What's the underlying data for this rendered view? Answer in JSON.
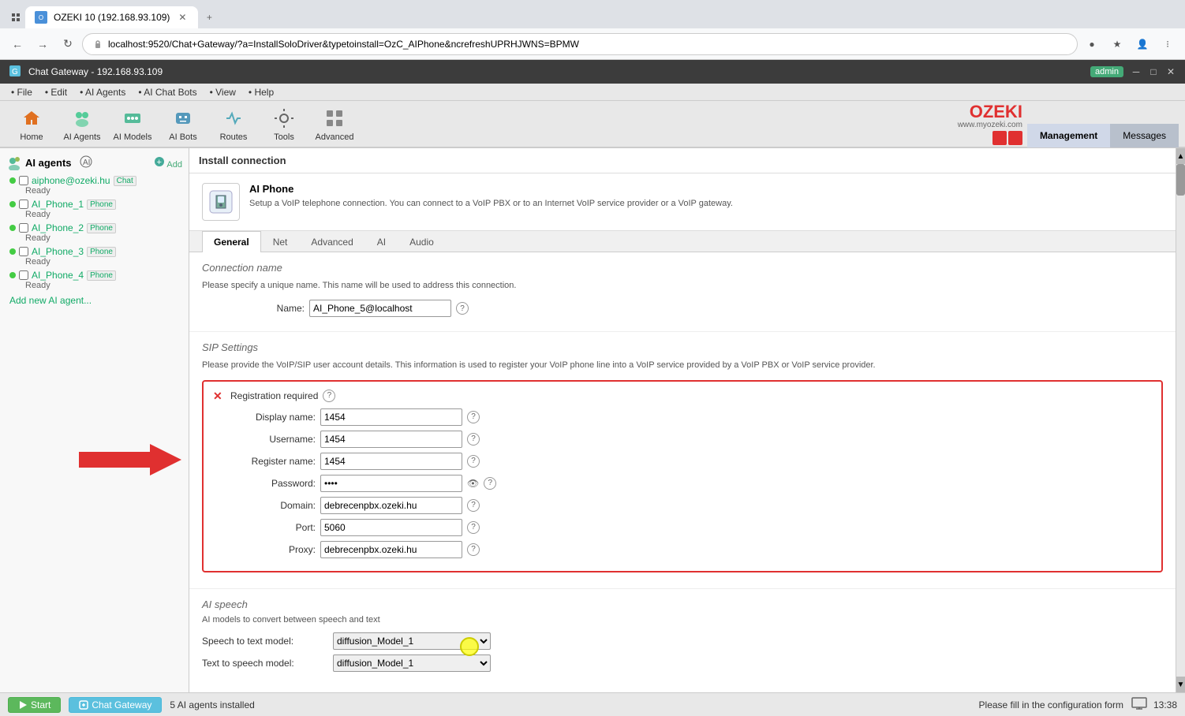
{
  "browser": {
    "tab_title": "OZEKI 10 (192.168.93.109)",
    "url": "localhost:9520/Chat+Gateway/?a=InstallSoloDriver&typetoinstall=OzC_AIPhone&ncrefreshUPRHJWNS=BPMW",
    "new_tab_symbol": "+"
  },
  "app": {
    "title": "Chat Gateway - 192.168.93.109",
    "admin_label": "admin"
  },
  "menubar": {
    "items": [
      "File",
      "Edit",
      "AI Agents",
      "AI Chat Bots",
      "View",
      "Help"
    ]
  },
  "toolbar": {
    "buttons": [
      {
        "id": "home",
        "label": "Home"
      },
      {
        "id": "ai-agents",
        "label": "AI Agents"
      },
      {
        "id": "ai-models",
        "label": "AI Models"
      },
      {
        "id": "ai-bots",
        "label": "AI Bots"
      },
      {
        "id": "routes",
        "label": "Routes"
      },
      {
        "id": "tools",
        "label": "Tools"
      },
      {
        "id": "advanced",
        "label": "Advanced"
      }
    ],
    "ozeki_logo": "OZEKI",
    "ozeki_sub": "www.myozeki.com",
    "management_tab": "Management",
    "messages_tab": "Messages"
  },
  "sidebar": {
    "title": "AI agents",
    "add_label": "Add",
    "agents": [
      {
        "name": "aiphone@ozeki.hu",
        "tag": "Chat",
        "status": "Ready"
      },
      {
        "name": "AI_Phone_1",
        "tag": "Phone",
        "status": "Ready"
      },
      {
        "name": "AI_Phone_2",
        "tag": "Phone",
        "status": "Ready"
      },
      {
        "name": "AI_Phone_3",
        "tag": "Phone",
        "status": "Ready"
      },
      {
        "name": "AI_Phone_4",
        "tag": "Phone",
        "status": "Ready"
      }
    ],
    "add_agent_link": "Add new AI agent..."
  },
  "content": {
    "install_header": "Install connection",
    "aiphone_title": "AI Phone",
    "aiphone_desc": "Setup a VoIP telephone connection. You can connect to a VoIP PBX or to an Internet VoIP service provider or a VoIP gateway.",
    "tabs": [
      "General",
      "Net",
      "Advanced",
      "AI",
      "Audio"
    ],
    "active_tab": "General",
    "connection_section": {
      "title": "Connection name",
      "desc": "Please specify a unique name. This name will be used to address this connection.",
      "name_label": "Name:",
      "name_value": "AI_Phone_5@localhost"
    },
    "sip_section": {
      "title": "SIP Settings",
      "desc": "Please provide the VoIP/SIP user account details. This information is used to register your VoIP phone line into a VoIP service provided by a VoIP PBX or VoIP service provider.",
      "reg_required": "Registration required",
      "fields": [
        {
          "label": "Display name:",
          "value": "1454"
        },
        {
          "label": "Username:",
          "value": "1454"
        },
        {
          "label": "Register name:",
          "value": "1454"
        },
        {
          "label": "Password:",
          "value": "••••",
          "type": "password"
        },
        {
          "label": "Domain:",
          "value": "debrecenpbx.ozeki.hu"
        },
        {
          "label": "Port:",
          "value": "5060"
        },
        {
          "label": "Proxy:",
          "value": "debrecenpbx.ozeki.hu"
        }
      ]
    },
    "ai_speech": {
      "title": "AI speech",
      "desc": "AI models to convert between speech and text",
      "speech_to_text_label": "Speech to text model:",
      "speech_to_text_value": "diffusion_Model_1",
      "text_to_speech_label": "Text to speech model:",
      "text_to_speech_value": "diffusion_Model_1",
      "options": [
        "diffusion_Model_1"
      ]
    }
  },
  "statusbar": {
    "agents_count": "5 AI agents installed",
    "fill_message": "Please fill in the configuration form",
    "start_label": "Start",
    "gateway_label": "Chat Gateway",
    "time": "13:38"
  }
}
